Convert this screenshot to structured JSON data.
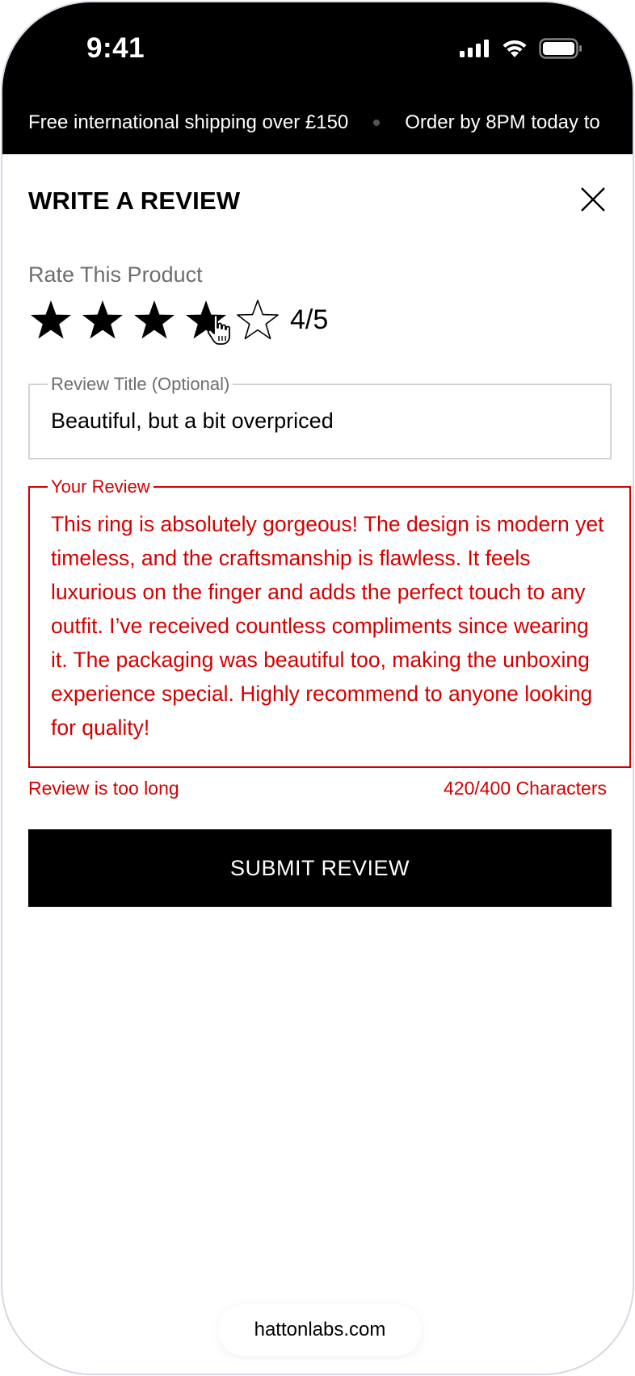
{
  "status_bar": {
    "time": "9:41",
    "icons": [
      "signal-icon",
      "wifi-icon",
      "battery-icon"
    ]
  },
  "announcement": {
    "items": [
      "Free international shipping over £150",
      "Order by 8PM today to"
    ]
  },
  "modal": {
    "title": "WRITE A REVIEW",
    "close_icon": "close-icon"
  },
  "rating": {
    "label": "Rate This Product",
    "value": 4,
    "max": 5,
    "display": "4/5"
  },
  "review_title": {
    "legend": "Review Title (Optional)",
    "value": "Beautiful, but a bit overpriced"
  },
  "review_body": {
    "legend": "Your Review",
    "value": "This ring is absolutely gorgeous! The design is modern yet timeless, and the craftsmanship is flawless. It feels luxurious on the finger and adds the perfect touch to any outfit. I’ve received countless compliments since wearing it. The packaging was beautiful too, making the unboxing experience special. Highly recommend to anyone looking for quality!",
    "error": "Review is too long",
    "char_count": "420/400 Characters"
  },
  "submit": {
    "label": "SUBMIT REVIEW"
  },
  "browser": {
    "url": "hattonlabs.com"
  },
  "colors": {
    "error": "#d40000",
    "primary": "#000000",
    "muted": "#6e6e6e",
    "border": "#d3d3d7"
  }
}
